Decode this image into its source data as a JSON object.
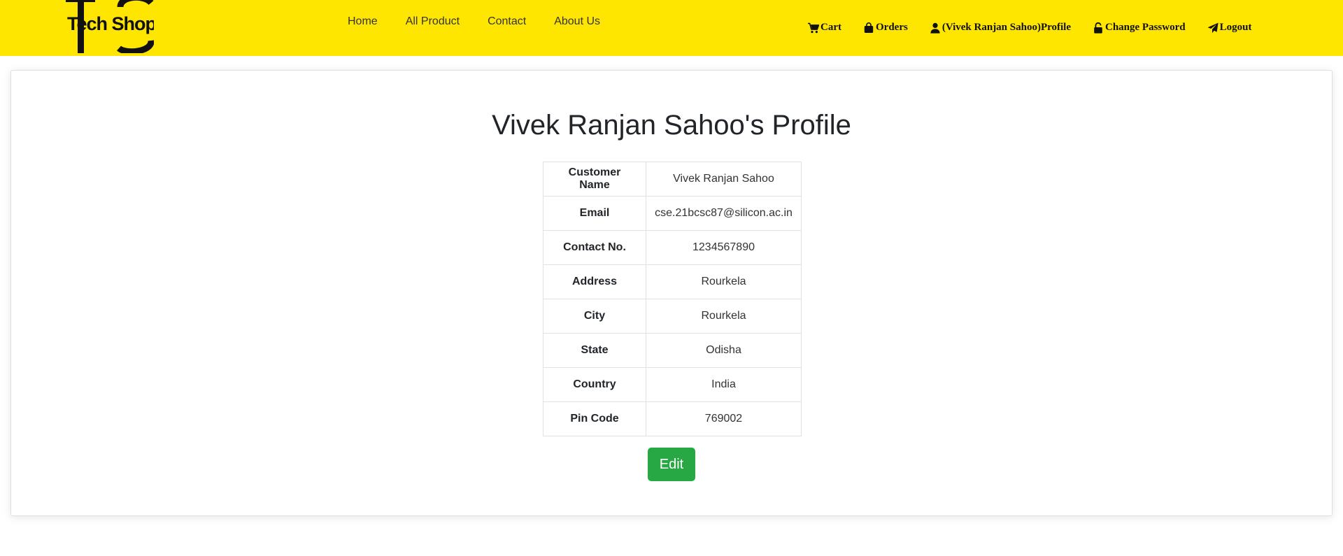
{
  "brand": {
    "name": "Tech Shop",
    "accent_color": "#ffe600"
  },
  "nav_left": [
    {
      "label": "Home"
    },
    {
      "label": "All Product"
    },
    {
      "label": "Contact"
    },
    {
      "label": "About Us"
    }
  ],
  "nav_right": [
    {
      "label": "Cart",
      "icon": "cart-icon"
    },
    {
      "label": "Orders",
      "icon": "shopping-bag-icon"
    },
    {
      "label": "(Vivek Ranjan Sahoo)Profile",
      "icon": "user-icon"
    },
    {
      "label": "Change Password",
      "icon": "unlock-icon"
    },
    {
      "label": "Logout",
      "icon": "paper-plane-icon"
    }
  ],
  "profile": {
    "title": "Vivek Ranjan Sahoo's Profile",
    "rows": [
      {
        "key": "Customer Name",
        "value": "Vivek Ranjan Sahoo"
      },
      {
        "key": "Email",
        "value": "cse.21bcsc87@silicon.ac.in"
      },
      {
        "key": "Contact No.",
        "value": "1234567890"
      },
      {
        "key": "Address",
        "value": "Rourkela"
      },
      {
        "key": "City",
        "value": "Rourkela"
      },
      {
        "key": "State",
        "value": "Odisha"
      },
      {
        "key": "Country",
        "value": "India"
      },
      {
        "key": "Pin Code",
        "value": "769002"
      }
    ],
    "edit_label": "Edit",
    "edit_color": "#28a745"
  }
}
